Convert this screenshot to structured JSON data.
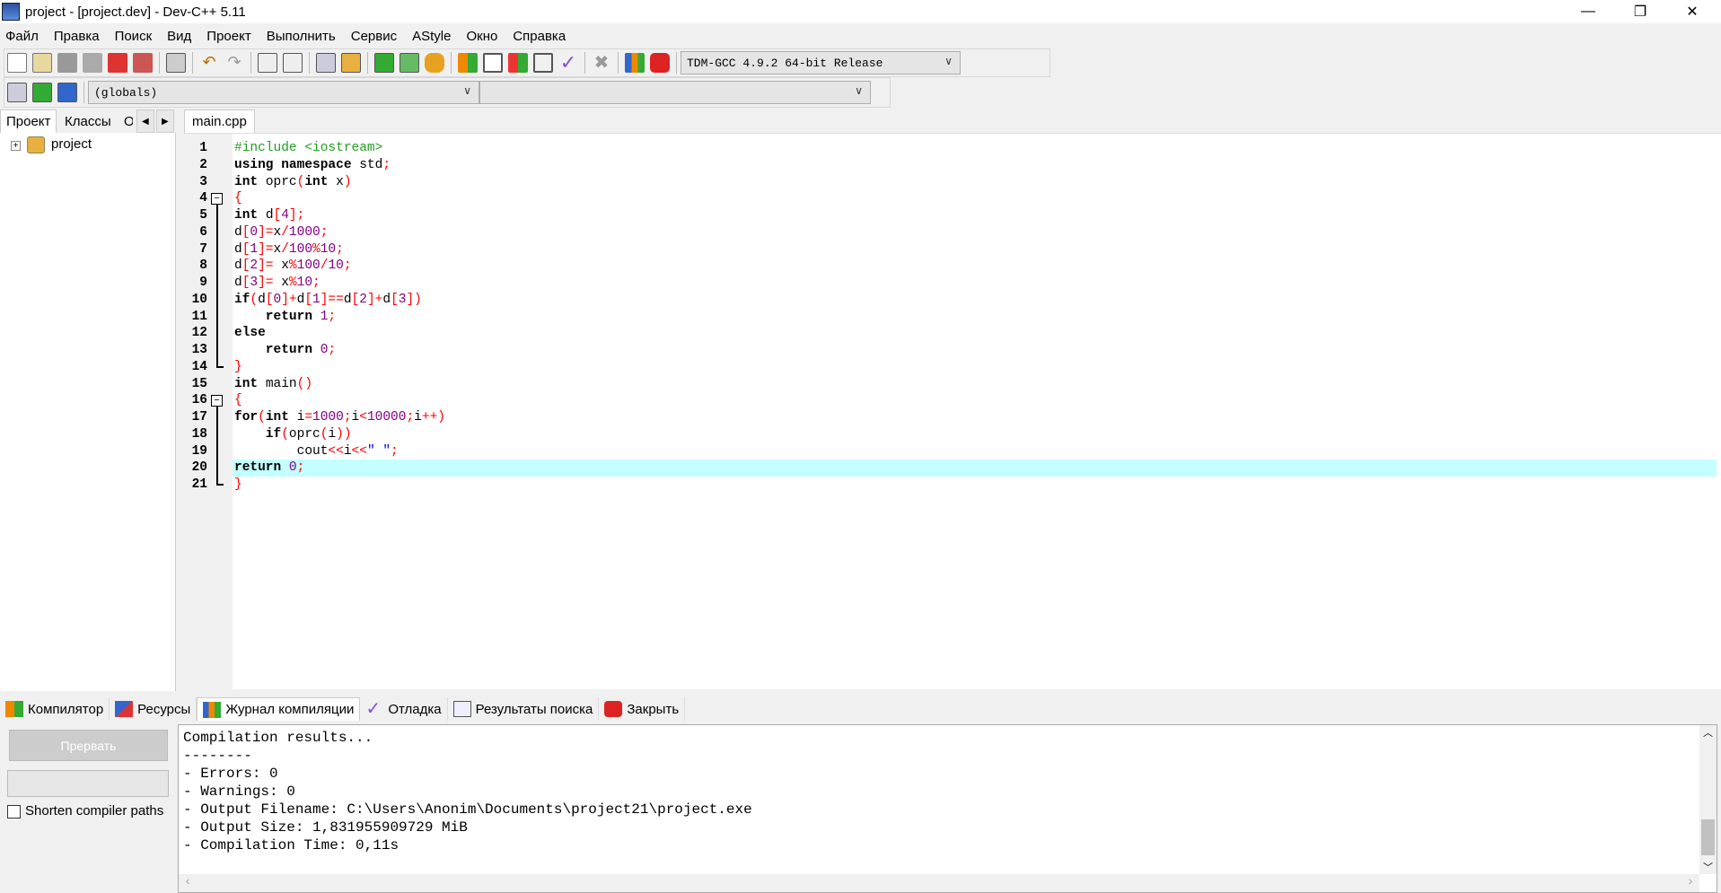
{
  "window": {
    "title": "project - [project.dev] - Dev-C++ 5.11",
    "minimize": "—",
    "restore": "❐",
    "close": "✕"
  },
  "menu": [
    "Файл",
    "Правка",
    "Поиск",
    "Вид",
    "Проект",
    "Выполнить",
    "Сервис",
    "AStyle",
    "Окно",
    "Справка"
  ],
  "toolbar": {
    "compiler": "TDM-GCC 4.9.2 64-bit Release",
    "scope": "(globals)",
    "member": ""
  },
  "left_tabs": [
    "Проект",
    "Классы",
    "О"
  ],
  "tree": {
    "root": "project"
  },
  "editor": {
    "tab": "main.cpp",
    "highlight_line": 20,
    "lines": [
      [
        [
          "#include <iostream>",
          "pp"
        ]
      ],
      [
        [
          "using namespace ",
          "kw"
        ],
        [
          "std",
          "id"
        ],
        [
          ";",
          "sym"
        ]
      ],
      [
        [
          "int ",
          "kw"
        ],
        [
          "oprc",
          "id"
        ],
        [
          "(",
          "sym"
        ],
        [
          "int ",
          "kw"
        ],
        [
          "x",
          "id"
        ],
        [
          ")",
          "sym"
        ]
      ],
      [
        [
          "{",
          "sym"
        ]
      ],
      [
        [
          "int ",
          "kw"
        ],
        [
          "d",
          "id"
        ],
        [
          "[",
          "sym"
        ],
        [
          "4",
          "num"
        ],
        [
          "];",
          "sym"
        ]
      ],
      [
        [
          "d",
          "id"
        ],
        [
          "[",
          "sym"
        ],
        [
          "0",
          "num"
        ],
        [
          "]=",
          "sym"
        ],
        [
          "x",
          "id"
        ],
        [
          "/",
          "sym"
        ],
        [
          "1000",
          "num"
        ],
        [
          ";",
          "sym"
        ]
      ],
      [
        [
          "d",
          "id"
        ],
        [
          "[",
          "sym"
        ],
        [
          "1",
          "num"
        ],
        [
          "]=",
          "sym"
        ],
        [
          "x",
          "id"
        ],
        [
          "/",
          "sym"
        ],
        [
          "100",
          "num"
        ],
        [
          "%",
          "sym"
        ],
        [
          "10",
          "num"
        ],
        [
          ";",
          "sym"
        ]
      ],
      [
        [
          "d",
          "id"
        ],
        [
          "[",
          "sym"
        ],
        [
          "2",
          "num"
        ],
        [
          "]= ",
          "sym"
        ],
        [
          "x",
          "id"
        ],
        [
          "%",
          "sym"
        ],
        [
          "100",
          "num"
        ],
        [
          "/",
          "sym"
        ],
        [
          "10",
          "num"
        ],
        [
          ";",
          "sym"
        ]
      ],
      [
        [
          "d",
          "id"
        ],
        [
          "[",
          "sym"
        ],
        [
          "3",
          "num"
        ],
        [
          "]= ",
          "sym"
        ],
        [
          "x",
          "id"
        ],
        [
          "%",
          "sym"
        ],
        [
          "10",
          "num"
        ],
        [
          ";",
          "sym"
        ]
      ],
      [
        [
          "if",
          "kw"
        ],
        [
          "(",
          "sym"
        ],
        [
          "d",
          "id"
        ],
        [
          "[",
          "sym"
        ],
        [
          "0",
          "num"
        ],
        [
          "]+",
          "sym"
        ],
        [
          "d",
          "id"
        ],
        [
          "[",
          "sym"
        ],
        [
          "1",
          "num"
        ],
        [
          "]==",
          "sym"
        ],
        [
          "d",
          "id"
        ],
        [
          "[",
          "sym"
        ],
        [
          "2",
          "num"
        ],
        [
          "]+",
          "sym"
        ],
        [
          "d",
          "id"
        ],
        [
          "[",
          "sym"
        ],
        [
          "3",
          "num"
        ],
        [
          "])",
          "sym"
        ]
      ],
      [
        [
          "    return ",
          "kw"
        ],
        [
          "1",
          "num"
        ],
        [
          ";",
          "sym"
        ]
      ],
      [
        [
          "else",
          "kw"
        ]
      ],
      [
        [
          "    return ",
          "kw"
        ],
        [
          "0",
          "num"
        ],
        [
          ";",
          "sym"
        ]
      ],
      [
        [
          "}",
          "sym"
        ]
      ],
      [
        [
          "int ",
          "kw"
        ],
        [
          "main",
          "id"
        ],
        [
          "()",
          "sym"
        ]
      ],
      [
        [
          "{",
          "sym"
        ]
      ],
      [
        [
          "for",
          "kw"
        ],
        [
          "(",
          "sym"
        ],
        [
          "int ",
          "kw"
        ],
        [
          "i",
          "id"
        ],
        [
          "=",
          "sym"
        ],
        [
          "1000",
          "num"
        ],
        [
          ";",
          "sym"
        ],
        [
          "i",
          "id"
        ],
        [
          "<",
          "sym"
        ],
        [
          "10000",
          "num"
        ],
        [
          ";",
          "sym"
        ],
        [
          "i",
          "id"
        ],
        [
          "++)",
          "sym"
        ]
      ],
      [
        [
          "    if",
          "kw"
        ],
        [
          "(",
          "sym"
        ],
        [
          "oprc",
          "id"
        ],
        [
          "(",
          "sym"
        ],
        [
          "i",
          "id"
        ],
        [
          "))",
          "sym"
        ]
      ],
      [
        [
          "        cout",
          "id"
        ],
        [
          "<<",
          "sym"
        ],
        [
          "i",
          "id"
        ],
        [
          "<<",
          "sym"
        ],
        [
          "\" \"",
          "str"
        ],
        [
          ";",
          "sym"
        ]
      ],
      [
        [
          "return ",
          "kw"
        ],
        [
          "0",
          "num"
        ],
        [
          ";",
          "sym"
        ]
      ],
      [
        [
          "}",
          "sym"
        ]
      ]
    ]
  },
  "bottom_tabs": [
    "Компилятор",
    "Ресурсы",
    "Журнал компиляции",
    "Отладка",
    "Результаты поиска",
    "Закрыть"
  ],
  "compile_panel": {
    "abort_button": "Прервать",
    "shorten_label": "Shorten compiler paths",
    "log": [
      "Compilation results...",
      "--------",
      "- Errors: 0",
      "- Warnings: 0",
      "- Output Filename: C:\\Users\\Anonim\\Documents\\project21\\project.exe",
      "- Output Size: 1,831955909729 MiB",
      "- Compilation Time: 0,11s"
    ]
  }
}
